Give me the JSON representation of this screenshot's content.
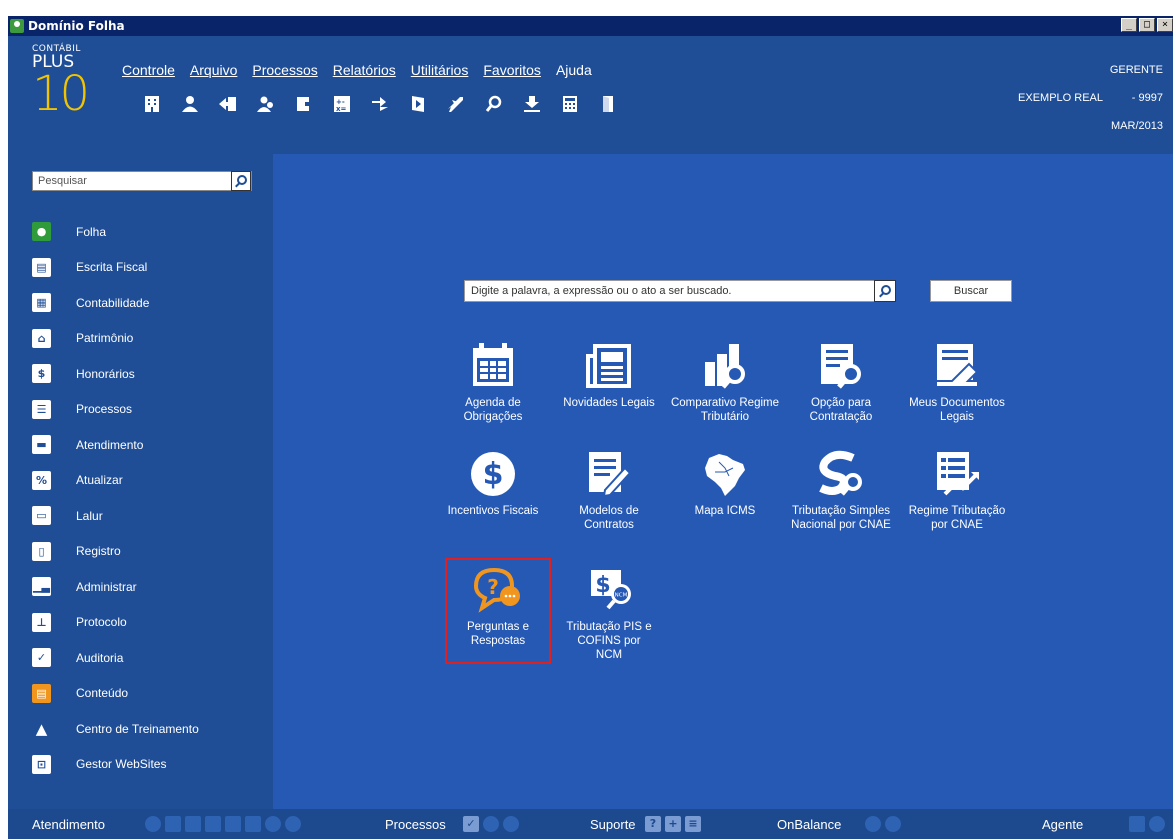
{
  "window": {
    "title": "Domínio Folha",
    "controls": [
      "_",
      "□",
      "×"
    ]
  },
  "logo": {
    "line1": "CONTÁBIL",
    "line2": "PLUS",
    "line3": "10"
  },
  "menu": [
    {
      "label": "Controle",
      "underline": true
    },
    {
      "label": "Arquivo",
      "underline": true
    },
    {
      "label": "Processos",
      "underline": true
    },
    {
      "label": "Relatórios",
      "underline": true
    },
    {
      "label": "Utilitários",
      "underline": true
    },
    {
      "label": "Favoritos",
      "underline": true
    },
    {
      "label": "Ajuda",
      "underline": false
    }
  ],
  "toolbar_icons": [
    "building-icon",
    "user-icon",
    "import-icon",
    "users-icon",
    "puzzle-icon",
    "calculator-grid-icon",
    "arrows-icon",
    "book-icon",
    "airplane-icon",
    "search-icon",
    "download-icon",
    "calculator-icon",
    "door-icon"
  ],
  "user": {
    "role": "GERENTE",
    "company": "EXEMPLO REAL",
    "code": "- 9997",
    "period": "MAR/2013"
  },
  "sidebar": {
    "search_placeholder": "Pesquisar",
    "items": [
      {
        "label": "Folha",
        "icon": "person-icon"
      },
      {
        "label": "Escrita Fiscal",
        "icon": "document-icon"
      },
      {
        "label": "Contabilidade",
        "icon": "calculator-icon"
      },
      {
        "label": "Patrimônio",
        "icon": "home-icon"
      },
      {
        "label": "Honorários",
        "icon": "dollar-icon"
      },
      {
        "label": "Processos",
        "icon": "list-icon"
      },
      {
        "label": "Atendimento",
        "icon": "briefcase-icon"
      },
      {
        "label": "Atualizar",
        "icon": "percent-icon"
      },
      {
        "label": "Lalur",
        "icon": "ledger-icon"
      },
      {
        "label": "Registro",
        "icon": "page-icon"
      },
      {
        "label": "Administrar",
        "icon": "bar-chart-icon"
      },
      {
        "label": "Protocolo",
        "icon": "stamp-icon"
      },
      {
        "label": "Auditoria",
        "icon": "checkbox-icon"
      },
      {
        "label": "Conteúdo",
        "icon": "content-icon"
      },
      {
        "label": "Centro de Treinamento",
        "icon": "graduation-cap-icon"
      },
      {
        "label": "Gestor WebSites",
        "icon": "website-icon"
      }
    ]
  },
  "main": {
    "search_placeholder": "Digite a palavra, a expressão ou o ato a ser buscado.",
    "search_button": "Buscar",
    "tiles": [
      {
        "label": "Agenda de Obrigações",
        "icon": "calendar-icon"
      },
      {
        "label": "Novidades Legais",
        "icon": "newspaper-icon"
      },
      {
        "label": "Comparativo Regime Tributário",
        "icon": "chart-search-icon"
      },
      {
        "label": "Opção para Contratação",
        "icon": "document-search-icon"
      },
      {
        "label": "Meus Documentos Legais",
        "icon": "document-stack-icon"
      },
      {
        "label": "Incentivos Fiscais",
        "icon": "dollar-coin-icon"
      },
      {
        "label": "Modelos de Contratos",
        "icon": "document-pen-icon"
      },
      {
        "label": "Mapa ICMS",
        "icon": "brazil-map-icon"
      },
      {
        "label": "Tributação Simples Nacional por CNAE",
        "icon": "s-search-icon"
      },
      {
        "label": "Regime Tributação por CNAE",
        "icon": "list-chart-icon"
      },
      {
        "label": "Perguntas e Respostas",
        "icon": "question-chat-icon"
      },
      {
        "label": "Tributação PIS e COFINS por NCM",
        "icon": "dollar-ncm-icon"
      }
    ],
    "highlight_color": "#e02020"
  },
  "bottombar": {
    "atendimento": "Atendimento",
    "processos": "Processos",
    "suporte": "Suporte",
    "onbalance": "OnBalance",
    "agente": "Agente"
  },
  "colors": {
    "header": "#1f4e96",
    "main": "#2659b4",
    "accent": "#f0961e"
  }
}
